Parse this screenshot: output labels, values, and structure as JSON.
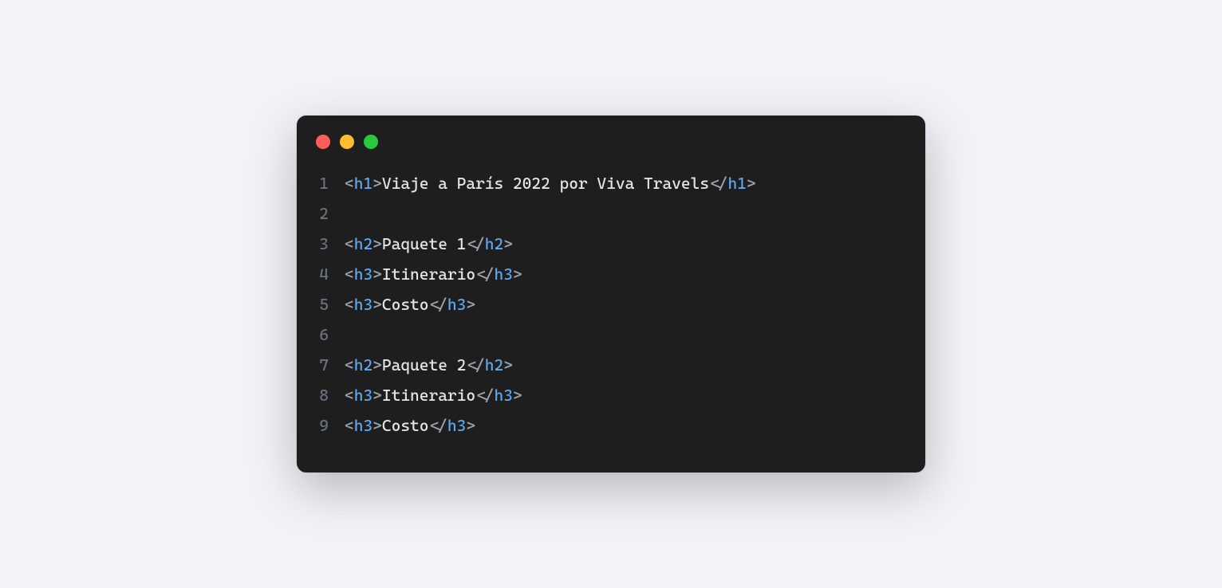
{
  "window": {
    "traffic_lights": [
      "close",
      "minimize",
      "maximize"
    ]
  },
  "code": {
    "lines": [
      {
        "num": "1",
        "tokens": [
          {
            "cls": "p",
            "txt": "<"
          },
          {
            "cls": "t",
            "txt": "h1"
          },
          {
            "cls": "p",
            "txt": ">"
          },
          {
            "cls": "tx",
            "txt": "Viaje a París 2022 por Viva Travels"
          },
          {
            "cls": "p",
            "txt": "</"
          },
          {
            "cls": "t",
            "txt": "h1"
          },
          {
            "cls": "p",
            "txt": ">"
          }
        ]
      },
      {
        "num": "2",
        "tokens": []
      },
      {
        "num": "3",
        "tokens": [
          {
            "cls": "p",
            "txt": "<"
          },
          {
            "cls": "t",
            "txt": "h2"
          },
          {
            "cls": "p",
            "txt": ">"
          },
          {
            "cls": "tx",
            "txt": "Paquete 1"
          },
          {
            "cls": "p",
            "txt": "</"
          },
          {
            "cls": "t",
            "txt": "h2"
          },
          {
            "cls": "p",
            "txt": ">"
          }
        ]
      },
      {
        "num": "4",
        "tokens": [
          {
            "cls": "p",
            "txt": "<"
          },
          {
            "cls": "t",
            "txt": "h3"
          },
          {
            "cls": "p",
            "txt": ">"
          },
          {
            "cls": "tx",
            "txt": "Itinerario"
          },
          {
            "cls": "p",
            "txt": "</"
          },
          {
            "cls": "t",
            "txt": "h3"
          },
          {
            "cls": "p",
            "txt": ">"
          }
        ]
      },
      {
        "num": "5",
        "tokens": [
          {
            "cls": "p",
            "txt": "<"
          },
          {
            "cls": "t",
            "txt": "h3"
          },
          {
            "cls": "p",
            "txt": ">"
          },
          {
            "cls": "tx",
            "txt": "Costo"
          },
          {
            "cls": "p",
            "txt": "</"
          },
          {
            "cls": "t",
            "txt": "h3"
          },
          {
            "cls": "p",
            "txt": ">"
          }
        ]
      },
      {
        "num": "6",
        "tokens": []
      },
      {
        "num": "7",
        "tokens": [
          {
            "cls": "p",
            "txt": "<"
          },
          {
            "cls": "t",
            "txt": "h2"
          },
          {
            "cls": "p",
            "txt": ">"
          },
          {
            "cls": "tx",
            "txt": "Paquete 2"
          },
          {
            "cls": "p",
            "txt": "</"
          },
          {
            "cls": "t",
            "txt": "h2"
          },
          {
            "cls": "p",
            "txt": ">"
          }
        ]
      },
      {
        "num": "8",
        "tokens": [
          {
            "cls": "p",
            "txt": "<"
          },
          {
            "cls": "t",
            "txt": "h3"
          },
          {
            "cls": "p",
            "txt": ">"
          },
          {
            "cls": "tx",
            "txt": "Itinerario"
          },
          {
            "cls": "p",
            "txt": "</"
          },
          {
            "cls": "t",
            "txt": "h3"
          },
          {
            "cls": "p",
            "txt": ">"
          }
        ]
      },
      {
        "num": "9",
        "tokens": [
          {
            "cls": "p",
            "txt": "<"
          },
          {
            "cls": "t",
            "txt": "h3"
          },
          {
            "cls": "p",
            "txt": ">"
          },
          {
            "cls": "tx",
            "txt": "Costo"
          },
          {
            "cls": "p",
            "txt": "</"
          },
          {
            "cls": "t",
            "txt": "h3"
          },
          {
            "cls": "p",
            "txt": ">"
          }
        ]
      }
    ]
  }
}
